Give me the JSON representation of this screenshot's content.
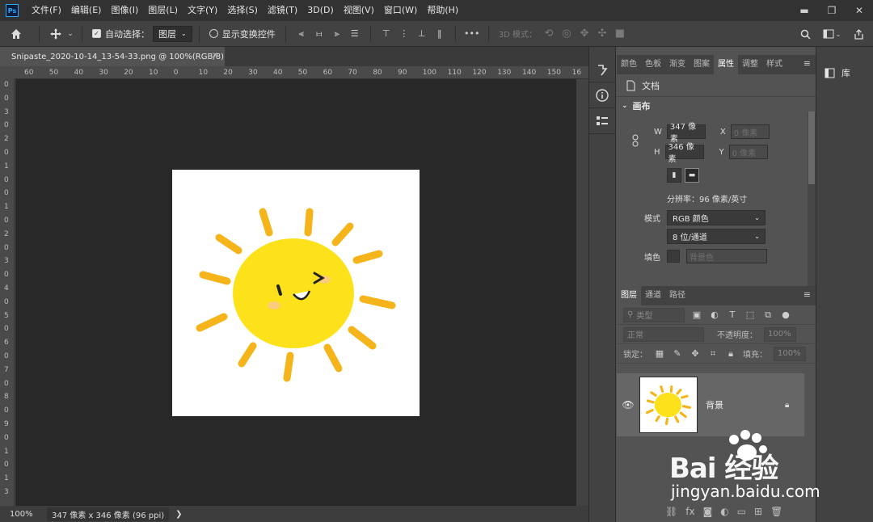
{
  "app": {
    "logo": "Ps"
  },
  "menu": [
    "文件(F)",
    "编辑(E)",
    "图像(I)",
    "图层(L)",
    "文字(Y)",
    "选择(S)",
    "滤镜(T)",
    "3D(D)",
    "视图(V)",
    "窗口(W)",
    "帮助(H)"
  ],
  "window_controls": {
    "minimize": "▬",
    "restore": "❐",
    "close": "✕"
  },
  "options": {
    "auto_select_label": "自动选择：",
    "auto_select_checked": true,
    "layer_dropdown": "图层",
    "show_transform_label": "显示变换控件",
    "show_transform_checked": false,
    "more": "•••",
    "mode_3d_label": "3D 模式："
  },
  "document": {
    "tab_title": "Snipaste_2020-10-14_13-54-33.png @ 100%(RGB/8)",
    "close": "×"
  },
  "ruler_h": [
    "60",
    "50",
    "40",
    "30",
    "20",
    "10",
    "0",
    "10",
    "20",
    "30",
    "40",
    "50",
    "60",
    "70",
    "80",
    "90",
    "100",
    "110",
    "120",
    "130",
    "140",
    "150",
    "16"
  ],
  "ruler_v": [
    "0",
    "0",
    "3",
    "0",
    "2",
    "0",
    "1",
    "0",
    "0",
    "1",
    "0",
    "2",
    "0",
    "3",
    "0",
    "4",
    "0",
    "5",
    "0",
    "6",
    "0",
    "7",
    "0",
    "8",
    "0",
    "9",
    "0",
    "1",
    "0",
    "1",
    "3"
  ],
  "status": {
    "zoom": "100%",
    "info": "347 像素 x 346 像素 (96 ppi)",
    "arrow": "❯"
  },
  "properties_panel": {
    "tabs": [
      "颜色",
      "色板",
      "渐变",
      "图案",
      "属性",
      "调整",
      "样式"
    ],
    "active_tab": "属性",
    "doc_label": "文档",
    "canvas_section": "画布",
    "w_label": "W",
    "w_value": "347 像素",
    "h_label": "H",
    "h_value": "346 像素",
    "x_label": "X",
    "x_value": "0 像素",
    "y_label": "Y",
    "y_value": "0 像素",
    "resolution": "分辨率：96 像素/英寸",
    "mode_label": "模式",
    "mode_value": "RGB 颜色",
    "depth_value": "8 位/通道",
    "fill_label": "填色",
    "fill_value": "背景色"
  },
  "layers_panel": {
    "tabs": [
      "图层",
      "通道",
      "路径"
    ],
    "active_tab": "图层",
    "search_placeholder": "类型",
    "blend_mode": "正常",
    "opacity_label": "不透明度：",
    "opacity_value": "100%",
    "lock_label": "锁定：",
    "fill_label": "填充：",
    "fill_value": "100%",
    "layer_name": "背景"
  },
  "library": {
    "label": "库"
  },
  "watermark": {
    "brand": "Bai 经验",
    "url": "jingyan.baidu.com"
  }
}
